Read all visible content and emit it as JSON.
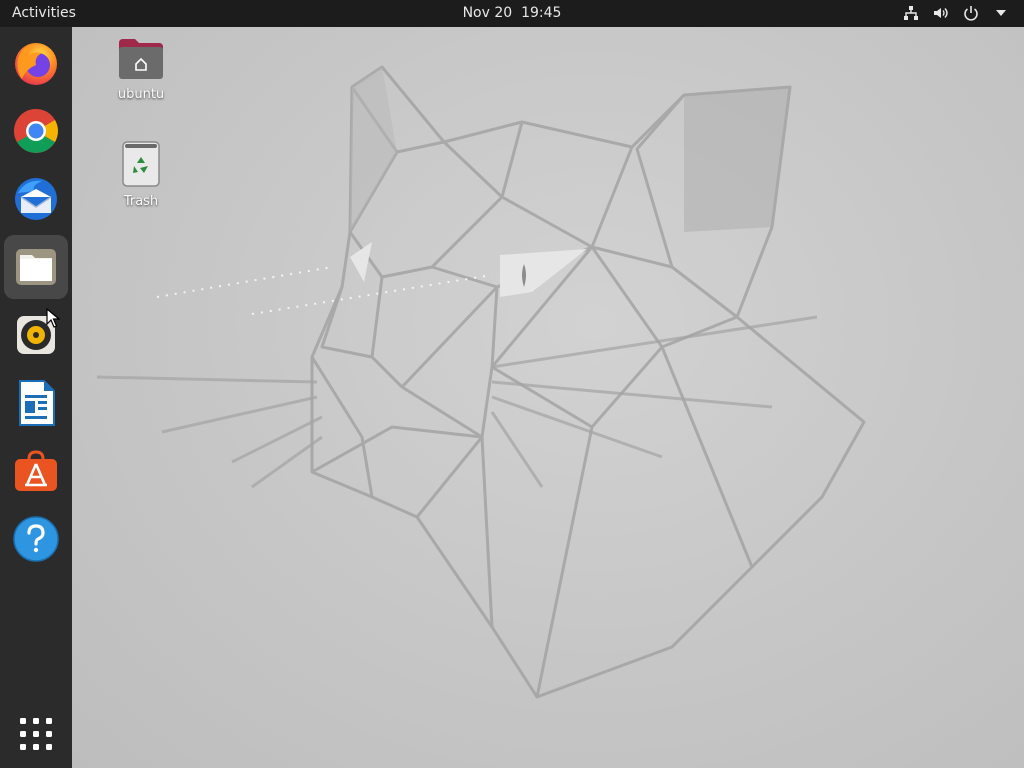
{
  "topbar": {
    "activities": "Activities",
    "date": "Nov 20",
    "time": "19:45",
    "tray": [
      "network-icon",
      "volume-icon",
      "power-icon",
      "chevron-down-icon"
    ]
  },
  "dock": {
    "items": [
      {
        "name": "firefox-icon",
        "app": "Firefox"
      },
      {
        "name": "chrome-icon",
        "app": "Google Chrome"
      },
      {
        "name": "thunderbird-icon",
        "app": "Thunderbird"
      },
      {
        "name": "files-icon",
        "app": "Files",
        "active": true
      },
      {
        "name": "rhythmbox-icon",
        "app": "Rhythmbox"
      },
      {
        "name": "writer-icon",
        "app": "LibreOffice Writer"
      },
      {
        "name": "software-icon",
        "app": "Ubuntu Software"
      },
      {
        "name": "help-icon",
        "app": "Help"
      }
    ],
    "show_apps": "apps-grid-icon"
  },
  "desktop": {
    "icons": [
      {
        "label": "ubuntu",
        "icon": "home-folder-icon"
      },
      {
        "label": "Trash",
        "icon": "trash-icon"
      }
    ]
  },
  "colors": {
    "topbar": "#1c1c1c",
    "dock": "#2b2b2b",
    "desktop": "#c9c9c9",
    "folder": "#6b6b6b",
    "folder_tab": "#a0284a",
    "ubuntu_orange": "#e95420"
  }
}
